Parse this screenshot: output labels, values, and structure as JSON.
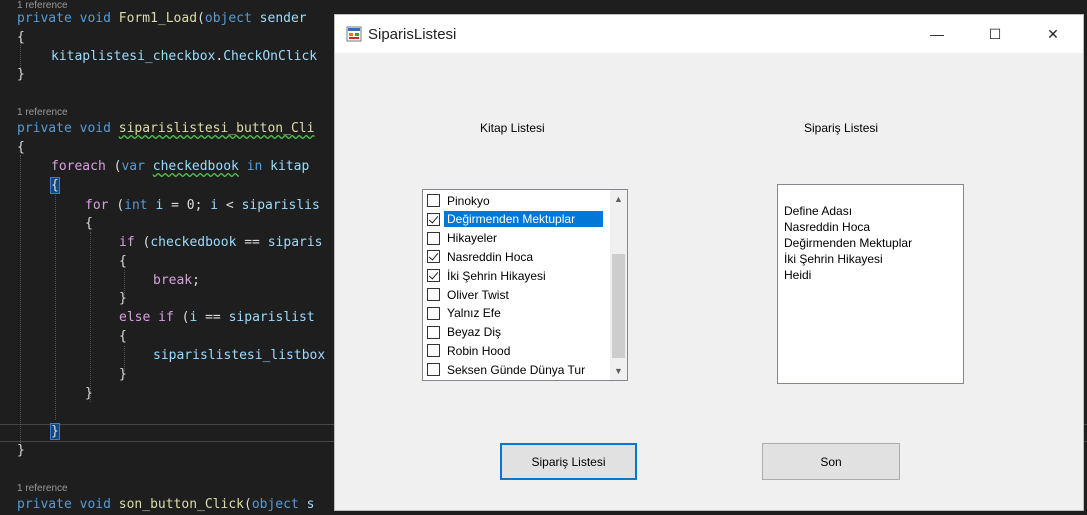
{
  "editor": {
    "ref1": "1 reference",
    "ref2": "1 reference",
    "ref3": "1 reference",
    "l1": {
      "a": "private",
      "b": "void",
      "c": "Form1_Load",
      "d": "(",
      "e": "object",
      "f": " sender"
    },
    "l2": "{",
    "l3": {
      "a": "kitaplistesi_checkbox",
      "b": ".",
      "c": "CheckOnClick"
    },
    "l4": "}",
    "l5": {
      "a": "private",
      "b": "void",
      "c": "siparislistesi_button_Cli"
    },
    "l6": "{",
    "l7": {
      "a": "foreach",
      "b": "(",
      "c": "var",
      "d": "checkedbook",
      "e": "in",
      "f": "kitap"
    },
    "l8": "{",
    "l9": {
      "a": "for",
      "b": "(",
      "c": "int",
      "d": "i",
      "e": " = 0; ",
      "f": "i",
      "g": " < ",
      "h": "siparislis"
    },
    "l10": "{",
    "l11": {
      "a": "if",
      "b": "(",
      "c": "checkedbook",
      "d": " == ",
      "e": "siparis"
    },
    "l12": "{",
    "l13": {
      "a": "break",
      "b": ";"
    },
    "l14": "}",
    "l15": {
      "a": "else",
      "b": "if",
      "c": "(",
      "d": "i",
      "e": " == ",
      "f": "siparislist"
    },
    "l16": "{",
    "l17": {
      "a": "siparislistesi_listbox"
    },
    "l18": "}",
    "l19": "}",
    "l20": "}",
    "l21": "}",
    "l22": {
      "a": "private",
      "b": "void",
      "c": "son_button_Click",
      "d": "(",
      "e": "object",
      "f": " s"
    }
  },
  "window": {
    "title": "SiparisListesi",
    "minimize": "—",
    "maximize": "☐",
    "close": "✕"
  },
  "form": {
    "books_label": "Kitap Listesi",
    "orders_label": "Sipariş Listesi",
    "books": [
      {
        "label": "Pinokyo",
        "checked": false
      },
      {
        "label": "Değirmenden Mektuplar",
        "checked": true
      },
      {
        "label": "Hikayeler",
        "checked": false
      },
      {
        "label": "Nasreddin Hoca",
        "checked": true
      },
      {
        "label": "İki Şehrin Hikayesi",
        "checked": true
      },
      {
        "label": "Oliver Twist",
        "checked": false
      },
      {
        "label": "Yalnız Efe",
        "checked": false
      },
      {
        "label": "Beyaz Diş",
        "checked": false
      },
      {
        "label": "Robin Hood",
        "checked": false
      },
      {
        "label": "Seksen Günde Dünya Tur",
        "checked": false
      }
    ],
    "selected_book_index": 1,
    "orders": [
      "Define Adası",
      "Nasreddin Hoca",
      "Değirmenden Mektuplar",
      "İki Şehrin Hikayesi",
      "Heidi"
    ],
    "order_button": "Sipariş Listesi",
    "end_button": "Son"
  },
  "colors": {
    "editor_bg": "#1e1e1e",
    "selection": "#0078d7",
    "window_bg": "#f0f0f0"
  }
}
